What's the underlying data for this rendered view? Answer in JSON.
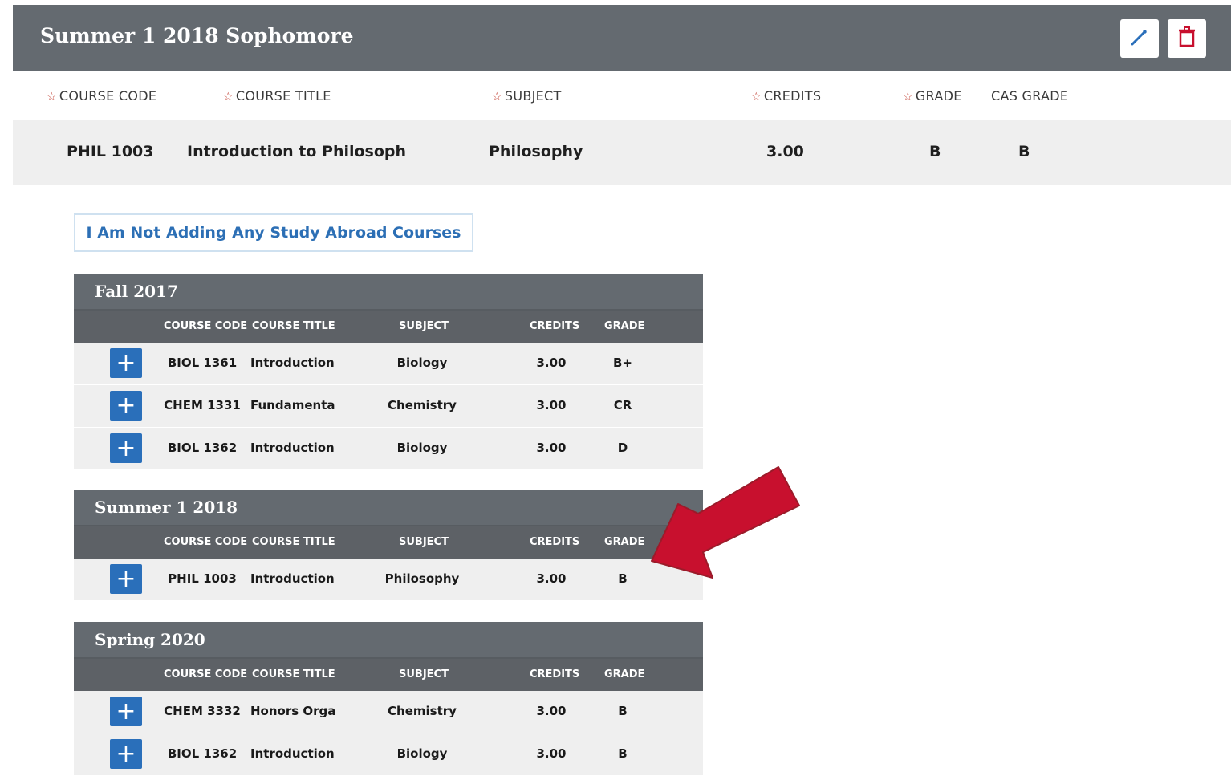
{
  "term": {
    "title": "Summer 1 2018 Sophomore",
    "columns": {
      "course_code": "COURSE CODE",
      "course_title": "COURSE TITLE",
      "subject": "SUBJECT",
      "credits": "CREDITS",
      "grade": "GRADE",
      "cas_grade": "CAS GRADE"
    },
    "row": {
      "code": "PHIL 1003",
      "title": "Introduction to Philosoph",
      "subject": "Philosophy",
      "credits": "3.00",
      "grade": "B",
      "cas_grade": "B"
    }
  },
  "not_adding_label": "I Am Not Adding Any Study Abroad Courses",
  "table_columns": {
    "code": "COURSE CODE",
    "title": "COURSE TITLE",
    "subject": "SUBJECT",
    "credits": "CREDITS",
    "grade": "GRADE"
  },
  "terms": [
    {
      "title": "Fall 2017",
      "rows": [
        {
          "code": "BIOL 1361",
          "title": "Introduction t",
          "subject": "Biology",
          "credits": "3.00",
          "grade": "B+"
        },
        {
          "code": "CHEM 1331",
          "title": "Fundamentals",
          "subject": "Chemistry",
          "credits": "3.00",
          "grade": "CR"
        },
        {
          "code": "BIOL 1362",
          "title": "Introduction t",
          "subject": "Biology",
          "credits": "3.00",
          "grade": "D"
        }
      ]
    },
    {
      "title": "Summer 1 2018",
      "rows": [
        {
          "code": "PHIL 1003",
          "title": "Introduction t",
          "subject": "Philosophy",
          "credits": "3.00",
          "grade": "B"
        }
      ]
    },
    {
      "title": "Spring 2020",
      "rows": [
        {
          "code": "CHEM 3332",
          "title": "Honors Orgar",
          "subject": "Chemistry",
          "credits": "3.00",
          "grade": "B"
        },
        {
          "code": "BIOL 1362",
          "title": "Introduction t",
          "subject": "Biology",
          "credits": "3.00",
          "grade": "B"
        }
      ]
    }
  ],
  "colors": {
    "header_bg": "#646a70",
    "accent_blue": "#2a6fba",
    "delete_red": "#c8102e",
    "arrow_red": "#c8102e"
  },
  "icons": {
    "edit": "pencil-icon",
    "delete": "trash-icon",
    "add": "plus-icon"
  }
}
